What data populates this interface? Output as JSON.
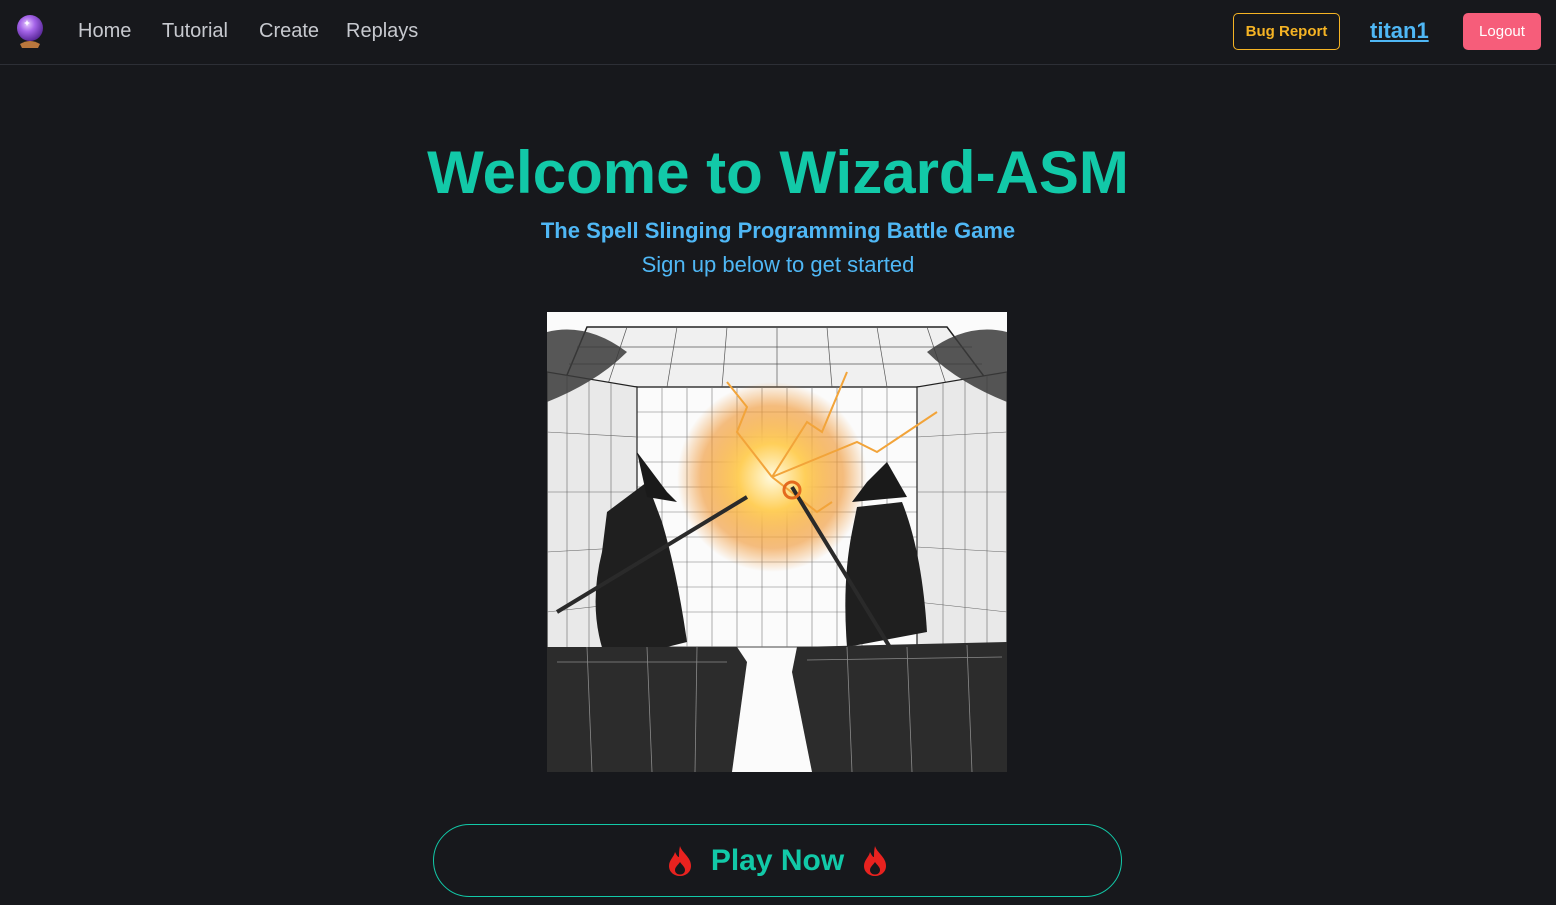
{
  "nav": {
    "logo_icon": "crystal-ball-icon",
    "links": [
      "Home",
      "Tutorial",
      "Create",
      "Replays"
    ],
    "bug_report_label": "Bug Report",
    "username": "titan1",
    "logout_label": "Logout"
  },
  "hero": {
    "title": "Welcome to Wizard-ASM",
    "subtitle": "The Spell Slinging Programming Battle Game",
    "cta_text": "Sign up below to get started",
    "image_icon": "wizard-battle-illustration"
  },
  "play_button": {
    "label": "Play Now",
    "icon": "fire-icon"
  },
  "colors": {
    "background": "#17181c",
    "accent": "#12c9a8",
    "link": "#4fb7f5",
    "warning": "#f5b324",
    "danger": "#f65d7a",
    "flame": "#e8221f"
  }
}
